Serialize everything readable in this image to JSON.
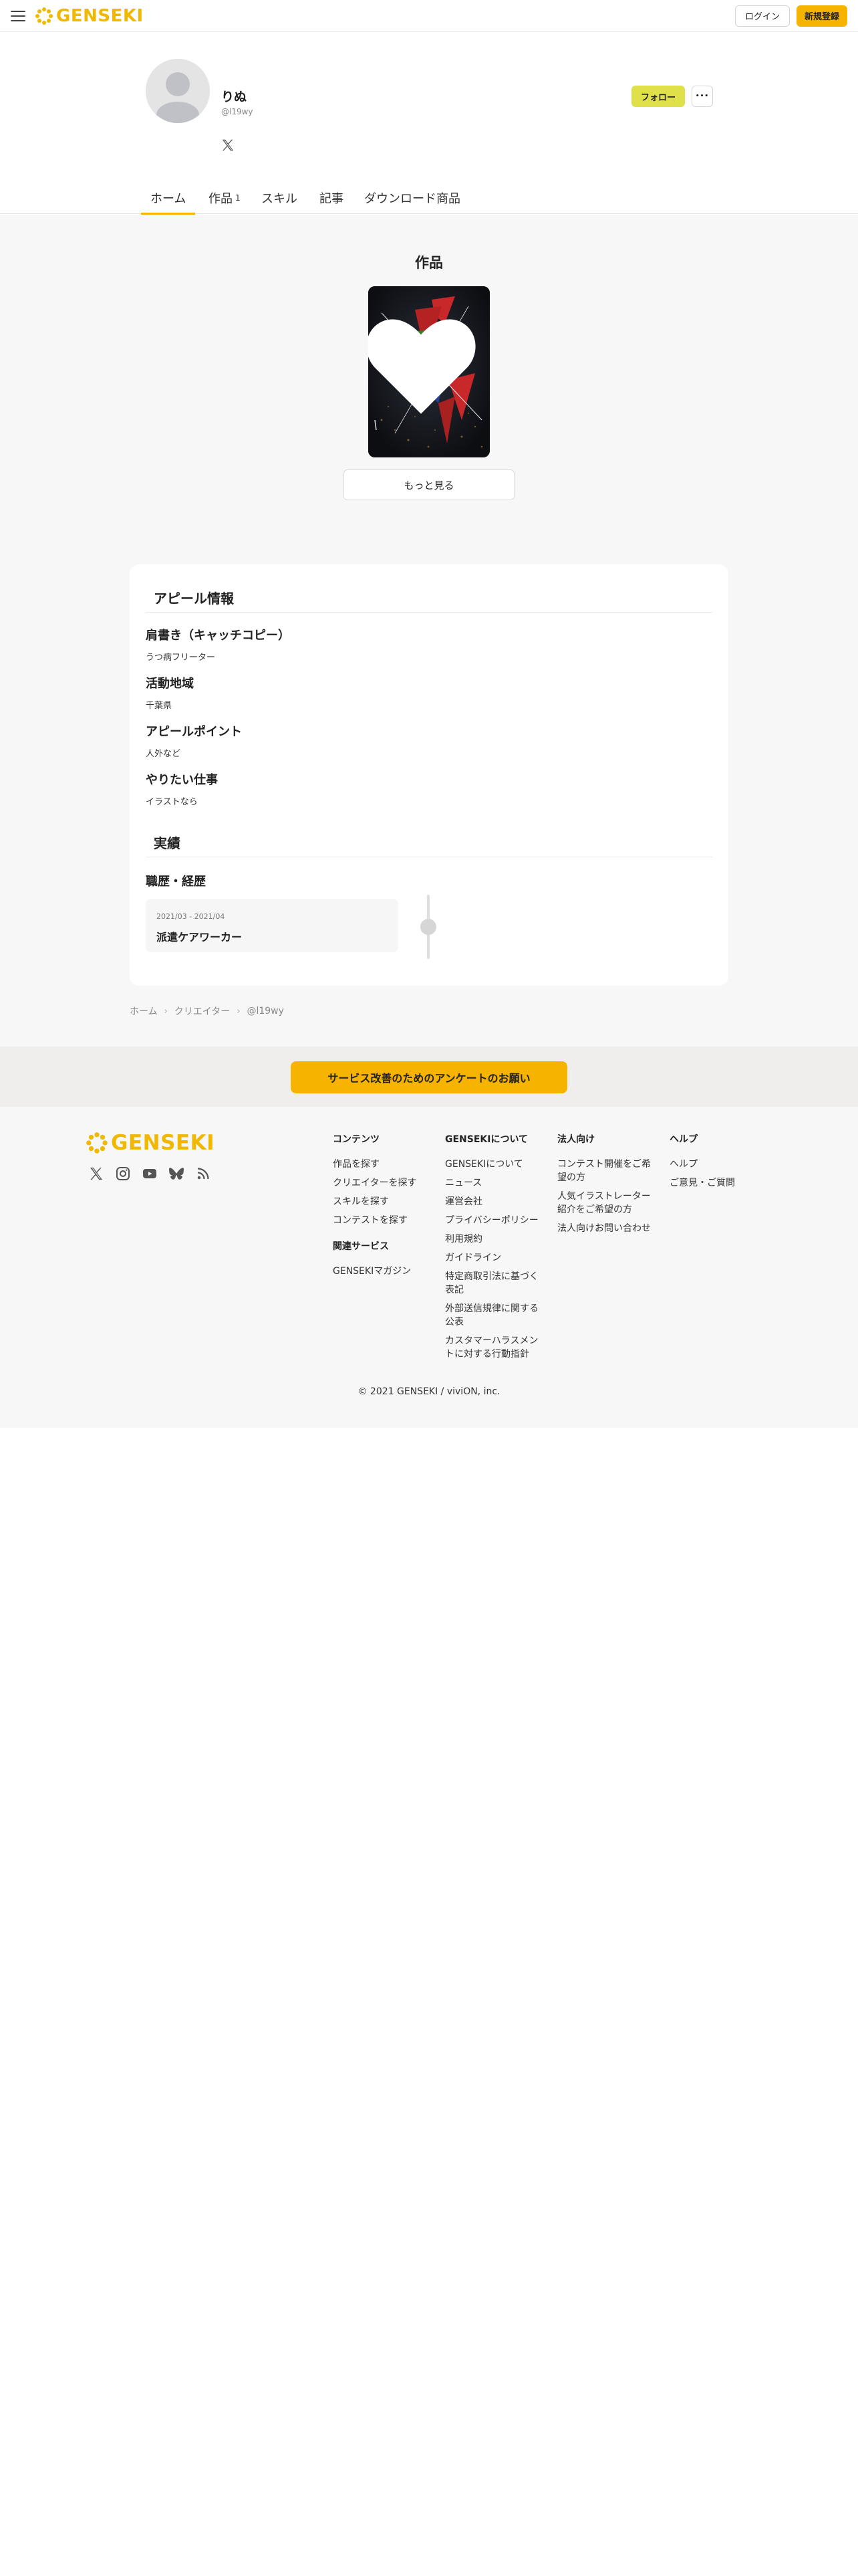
{
  "header": {
    "logo_text": "GENSEKI",
    "login_label": "ログイン",
    "register_label": "新規登録"
  },
  "profile": {
    "name": "りぬ",
    "handle": "@l19wy",
    "follow_label": "フォロー",
    "more_label": "•••"
  },
  "tabs": [
    {
      "label": "ホーム",
      "count": ""
    },
    {
      "label": "作品",
      "count": "1"
    },
    {
      "label": "スキル",
      "count": ""
    },
    {
      "label": "記事",
      "count": ""
    },
    {
      "label": "ダウンロード商品",
      "count": ""
    }
  ],
  "works": {
    "title": "作品",
    "see_more_label": "もっと見る"
  },
  "appeal": {
    "title": "アピール情報",
    "fields": [
      {
        "label": "肩書き（キャッチコピー）",
        "value": "うつ病フリーター"
      },
      {
        "label": "活動地域",
        "value": "千葉県"
      },
      {
        "label": "アピールポイント",
        "value": "人外など"
      },
      {
        "label": "やりたい仕事",
        "value": "イラストなら"
      }
    ]
  },
  "achievements": {
    "title": "実績",
    "career_label": "職歴・経歴",
    "career": {
      "date": "2021/03 - 2021/04",
      "title": "派遣ケアワーカー"
    }
  },
  "breadcrumb": [
    "ホーム",
    "クリエイター",
    "@l19wy"
  ],
  "survey_label": "サービス改善のためのアンケートのお願い",
  "footer": {
    "logo_text": "GENSEKI",
    "col_contents": {
      "title": "コンテンツ",
      "links": [
        "作品を探す",
        "クリエイターを探す",
        "スキルを探す",
        "コンテストを探す"
      ],
      "sub_title": "関連サービス",
      "sub_links": [
        "GENSEKIマガジン"
      ]
    },
    "col_about": {
      "title": "GENSEKIについて",
      "links": [
        "GENSEKIについて",
        "ニュース",
        "運営会社",
        "プライバシーポリシー",
        "利用規約",
        "ガイドライン",
        "特定商取引法に基づく表記",
        "外部送信規律に関する公表",
        "カスタマーハラスメントに対する行動指針"
      ]
    },
    "col_corporate": {
      "title": "法人向け",
      "links": [
        "コンテスト開催をご希望の方",
        "人気イラストレーター紹介をご希望の方",
        "法人向けお問い合わせ"
      ]
    },
    "col_help": {
      "title": "ヘルプ",
      "links": [
        "ヘルプ",
        "ご意見・ご質問"
      ]
    },
    "copyright": "© 2021 GENSEKI / viviON, inc."
  },
  "colors": {
    "accent": "#f6b300",
    "follow": "#dfe04a",
    "logo": "#f0b800"
  }
}
